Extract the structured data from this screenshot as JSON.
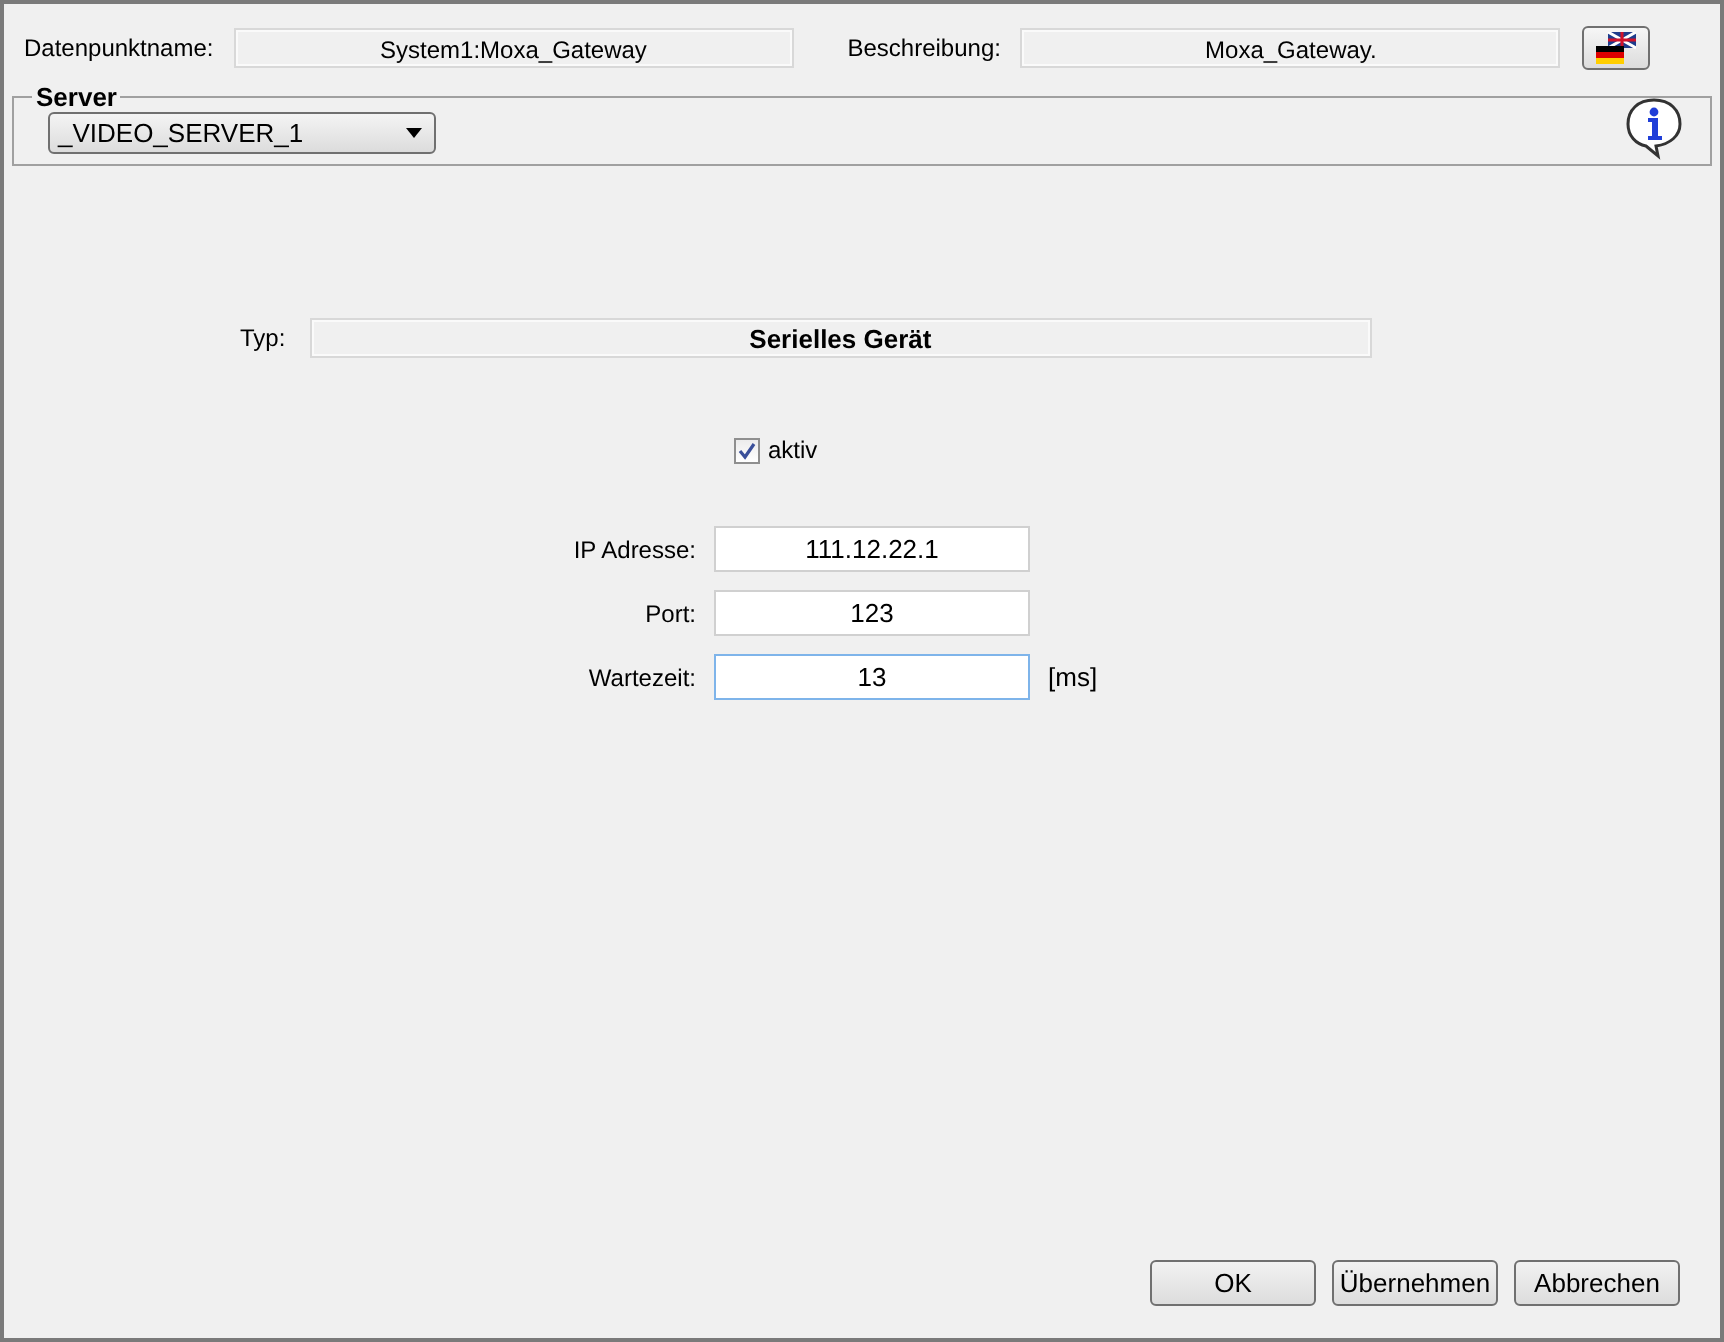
{
  "header": {
    "name_label": "Datenpunktname:",
    "name_value": "System1:Moxa_Gateway",
    "description_label": "Beschreibung:",
    "description_value": "Moxa_Gateway."
  },
  "server": {
    "title": "Server",
    "selected_server": "_VIDEO_SERVER_1"
  },
  "type": {
    "label": "Typ:",
    "value": "Serielles Gerät"
  },
  "active": {
    "label": "aktiv",
    "checked": true
  },
  "fields": [
    {
      "label": "IP Adresse:",
      "value": "111.12.22.1",
      "focused": false
    },
    {
      "label": "Port:",
      "value": "123",
      "focused": false
    },
    {
      "label": "Wartezeit:",
      "value": "13",
      "unit": "[ms]",
      "focused": true
    }
  ],
  "buttons": [
    "OK",
    "Übernehmen",
    "Abbrechen"
  ]
}
